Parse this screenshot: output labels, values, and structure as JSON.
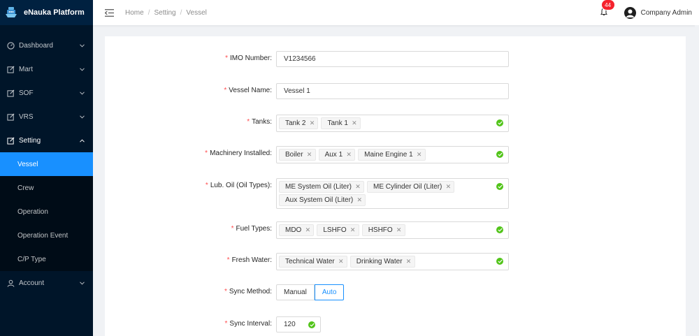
{
  "app": {
    "title": "eNauka Platform"
  },
  "sidebar": {
    "items": [
      {
        "label": "Dashboard",
        "icon": "dashboard-icon"
      },
      {
        "label": "Mart",
        "icon": "edit-icon"
      },
      {
        "label": "SOF",
        "icon": "edit-icon"
      },
      {
        "label": "VRS",
        "icon": "edit-icon"
      },
      {
        "label": "Setting",
        "icon": "edit-icon",
        "open": true,
        "children": [
          "Vessel",
          "Crew",
          "Operation",
          "Operation Event",
          "C/P Type"
        ],
        "active_child": "Vessel"
      },
      {
        "label": "Account",
        "icon": "user-icon"
      }
    ]
  },
  "header": {
    "breadcrumb": [
      "Home",
      "Setting",
      "Vessel"
    ],
    "notifications": "44",
    "user": "Company Admin"
  },
  "form": {
    "imo": {
      "label": "IMO Number",
      "value": "V1234566"
    },
    "vessel_name": {
      "label": "Vessel Name",
      "value": "Vessel 1"
    },
    "tanks": {
      "label": "Tanks",
      "tags": [
        "Tank 2",
        "Tank 1"
      ]
    },
    "machinery": {
      "label": "Machinery Installed",
      "tags": [
        "Boiler",
        "Aux 1",
        "Maine Engine 1"
      ]
    },
    "lub_oil": {
      "label": "Lub. Oil (Oil Types)",
      "tags": [
        "ME System Oil (Liter)",
        "ME Cylinder Oil (Liter)",
        "Aux System Oil (Liter)"
      ]
    },
    "fuel": {
      "label": "Fuel Types",
      "tags": [
        "MDO",
        "LSHFO",
        "HSHFO"
      ]
    },
    "fresh_water": {
      "label": "Fresh Water",
      "tags": [
        "Technical Water",
        "Drinking Water"
      ]
    },
    "sync_method": {
      "label": "Sync Method",
      "options": [
        "Manual",
        "Auto"
      ],
      "selected": "Auto"
    },
    "sync_interval": {
      "label": "Sync Interval",
      "value": "120"
    }
  },
  "colors": {
    "primary": "#1890ff",
    "sidebar": "#001529",
    "required": "#ff4d4f",
    "success": "#52c41a"
  }
}
